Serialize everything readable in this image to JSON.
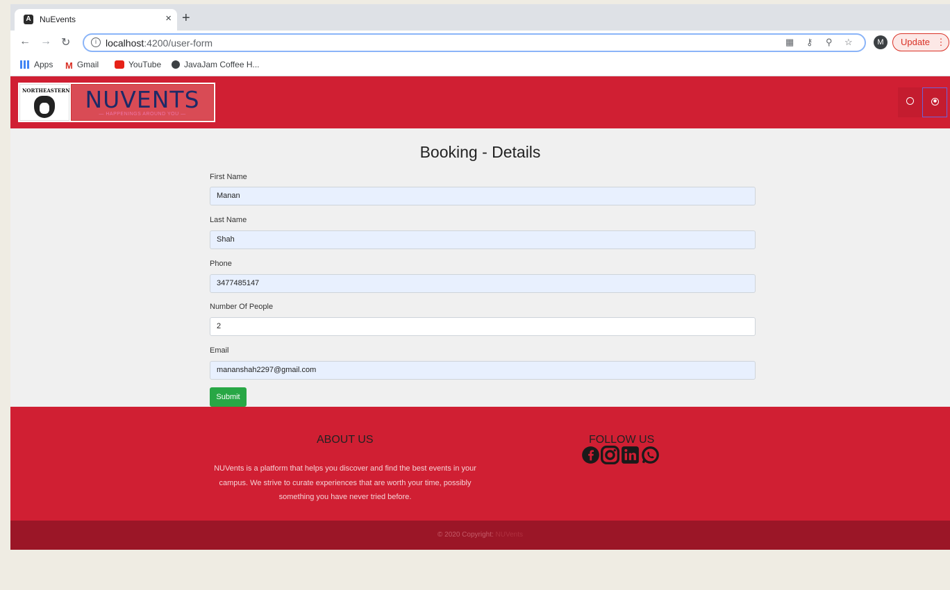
{
  "browser": {
    "tab_title": "NuEvents",
    "tab_close": "×",
    "new_tab": "+",
    "url_host": "localhost",
    "url_path": ":4200/user-form",
    "avatar_letter": "M",
    "update_label": "Update",
    "bookmarks": [
      "Apps",
      "Gmail",
      "YouTube",
      "JavaJam Coffee H..."
    ]
  },
  "header": {
    "logo_text": "NUVENTS",
    "logo_subtitle": "— HAPPENINGS AROUND YOU —",
    "logo_school": "NORTHEASTERN"
  },
  "form": {
    "title": "Booking - Details",
    "first_name_label": "First Name",
    "first_name_value": "Manan",
    "last_name_label": "Last Name",
    "last_name_value": "Shah",
    "phone_label": "Phone",
    "phone_value": "3477485147",
    "people_label": "Number Of People",
    "people_value": "2",
    "email_label": "Email",
    "email_value": "mananshah2297@gmail.com",
    "submit_label": "Submit"
  },
  "footer": {
    "about_title": "ABOUT US",
    "about_text": "NUVents is a platform that helps you discover and find the best events in your campus. We strive to curate experiences that are worth your time, possibly something you have never tried before.",
    "follow_title": "FOLLOW US",
    "copyright_prefix": "© 2020 Copyright: ",
    "copyright_brand": "NUVents"
  },
  "colors": {
    "brand_red": "#d01f33",
    "dark_red": "#9b1627",
    "submit_green": "#28a745"
  }
}
